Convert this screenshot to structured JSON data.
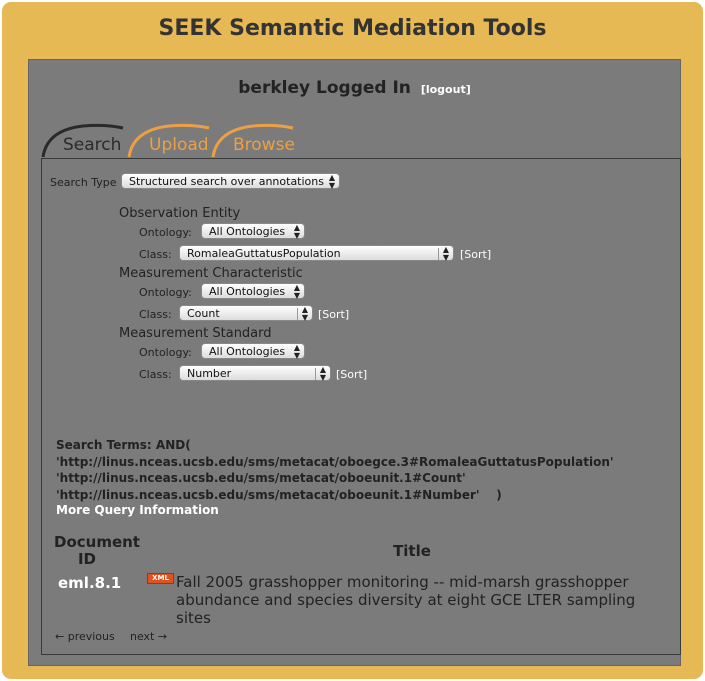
{
  "app": {
    "title": "SEEK Semantic Mediation Tools"
  },
  "login": {
    "user_text": "berkley Logged In",
    "logout_label": "[logout]"
  },
  "tabs": [
    {
      "label": "Search",
      "active": true
    },
    {
      "label": "Upload",
      "active": false
    },
    {
      "label": "Browse",
      "active": false
    }
  ],
  "search": {
    "type_label": "Search Type",
    "type_value": "Structured search over annotations"
  },
  "groups": {
    "observation": {
      "heading": "Observation Entity",
      "ontology_label": "Ontology:",
      "ontology_value": "All Ontologies",
      "class_label": "Class:",
      "class_value": "RomaleaGuttatusPopulation",
      "sort_label": "[Sort]"
    },
    "characteristic": {
      "heading": "Measurement Characteristic",
      "ontology_label": "Ontology:",
      "ontology_value": "All Ontologies",
      "class_label": "Class:",
      "class_value": "Count",
      "sort_label": "[Sort]"
    },
    "standard": {
      "heading": "Measurement Standard",
      "ontology_label": "Ontology:",
      "ontology_value": "All Ontologies",
      "class_label": "Class:",
      "class_value": "Number",
      "sort_label": "[Sort]"
    }
  },
  "query": {
    "terms_line1": "Search Terms: AND(",
    "terms_line2": "'http://linus.nceas.ucsb.edu/sms/metacat/oboegce.3#RomaleaGuttatusPopulation'",
    "terms_line3": "'http://linus.nceas.ucsb.edu/sms/metacat/oboeunit.1#Count'",
    "terms_line4": "'http://linus.nceas.ucsb.edu/sms/metacat/oboeunit.1#Number'    )",
    "more_label": "More Query Information"
  },
  "results": {
    "col_docid": "Document ID",
    "col_title": "Title",
    "rows": [
      {
        "doc_id": "eml.8.1",
        "badge": "XML",
        "title": "Fall 2005 grasshopper monitoring -- mid-marsh grasshopper abundance and species diversity at eight GCE LTER sampling sites"
      }
    ]
  },
  "pager": {
    "previous": "← previous",
    "next": "next →"
  },
  "colors": {
    "frame": "#e6b954",
    "panel": "#7b7b7b",
    "inactive_tab": "#eba045",
    "xml_badge": "#e0521e"
  }
}
